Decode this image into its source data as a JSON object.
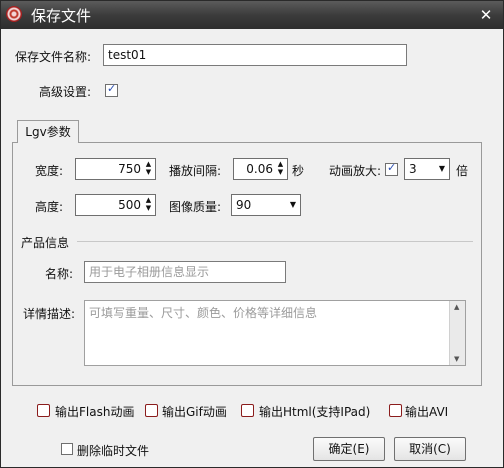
{
  "window": {
    "title": "保存文件"
  },
  "main": {
    "file_name_label": "保存文件名称:",
    "file_name_value": "test01",
    "advanced_label": "高级设置:",
    "advanced_checked": true
  },
  "tab": {
    "label": "Lgv参数"
  },
  "params": {
    "width_label": "宽度:",
    "width_value": "750",
    "interval_label": "播放间隔:",
    "interval_value": "0.06",
    "interval_unit": "秒",
    "zoom_label": "动画放大:",
    "zoom_checked": true,
    "zoom_value": "3",
    "zoom_unit": "倍",
    "height_label": "高度:",
    "height_value": "500",
    "quality_label": "图像质量:",
    "quality_value": "90"
  },
  "product": {
    "section_label": "产品信息",
    "name_label": "名称:",
    "name_placeholder": "用于电子相册信息显示",
    "detail_label": "详情描述:",
    "detail_placeholder": "可填写重量、尺寸、颜色、价格等详细信息"
  },
  "outputs": [
    {
      "label": "输出Flash动画",
      "checked": false
    },
    {
      "label": "输出Gif动画",
      "checked": false
    },
    {
      "label": "输出Html(支持IPad)",
      "checked": false
    },
    {
      "label": "输出AVI",
      "checked": false
    }
  ],
  "footer": {
    "delete_temp_label": "删除临时文件",
    "delete_temp_checked": false,
    "ok_label": "确定(E)",
    "cancel_label": "取消(C)"
  },
  "icons": {
    "app": "app-icon",
    "close": "close-icon"
  }
}
